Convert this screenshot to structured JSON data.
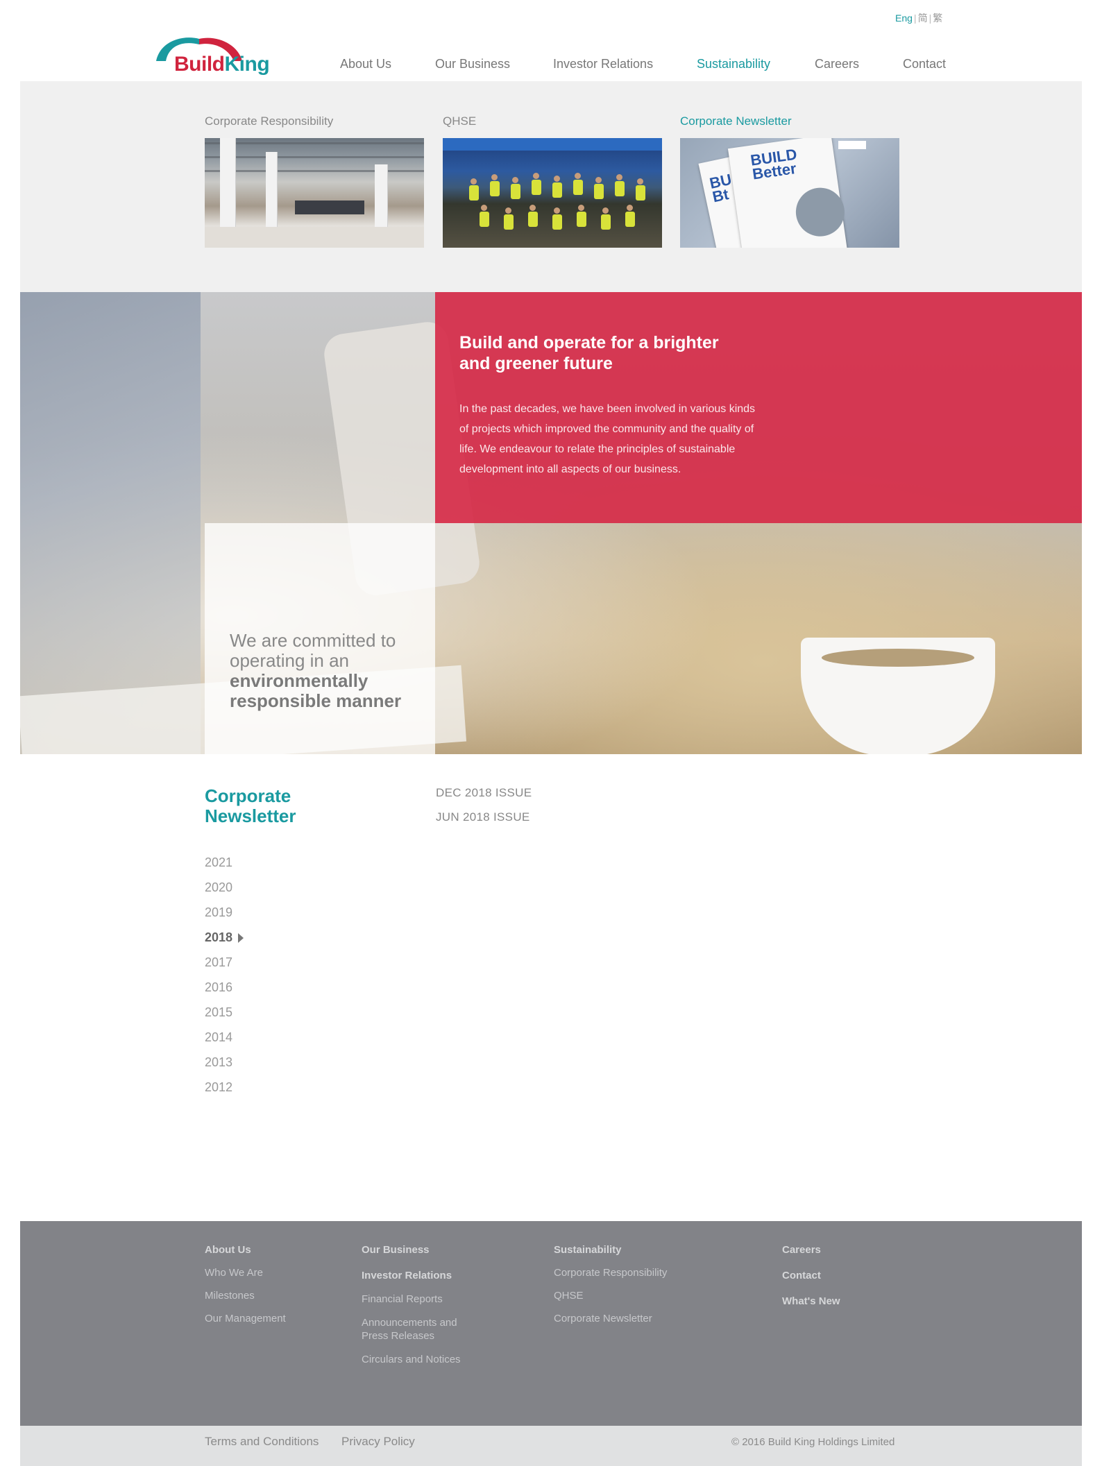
{
  "language": {
    "options": [
      "Eng",
      "简",
      "繁"
    ],
    "active": "Eng"
  },
  "logo": {
    "build": "Build",
    "king": "King"
  },
  "nav": {
    "items": [
      "About Us",
      "Our Business",
      "Investor Relations",
      "Sustainability",
      "Careers",
      "Contact"
    ],
    "active": "Sustainability"
  },
  "submenu": {
    "items": [
      {
        "label": "Corporate Responsibility"
      },
      {
        "label": "QHSE"
      },
      {
        "label": "Corporate Newsletter"
      }
    ],
    "active": "Corporate Newsletter"
  },
  "hero": {
    "heading": "Build and operate for a brighter and greener future",
    "body": "In the past decades, we have been involved in various kinds of projects which improved the community and the quality of life. We endeavour to relate the principles of sustainable development into all aspects of our business.",
    "quote_light": "We are committed to operating in an",
    "quote_bold": "environmentally responsible manner"
  },
  "newsletter": {
    "title": "Corporate Newsletter",
    "issues": [
      "DEC 2018 ISSUE",
      "JUN 2018 ISSUE"
    ],
    "years": [
      "2021",
      "2020",
      "2019",
      "2018",
      "2017",
      "2016",
      "2015",
      "2014",
      "2013",
      "2012"
    ],
    "selected_year": "2018"
  },
  "footer": {
    "about": {
      "heading": "About Us",
      "links": [
        "Who We Are",
        "Milestones",
        "Our Management"
      ]
    },
    "business": {
      "heading": "Our Business"
    },
    "investor": {
      "heading": "Investor Relations",
      "links": [
        "Financial Reports",
        "Announcements and Press Releases",
        "Circulars and Notices"
      ]
    },
    "sustainability": {
      "heading": "Sustainability",
      "links": [
        "Corporate Responsibility",
        "QHSE",
        "Corporate Newsletter"
      ]
    },
    "careers": {
      "heading": "Careers"
    },
    "contact": {
      "heading": "Contact"
    },
    "whats_new": {
      "heading": "What's New"
    },
    "terms": "Terms and Conditions",
    "privacy": "Privacy Policy",
    "copyright": "© 2016 Build King Holdings Limited"
  },
  "colors": {
    "teal": "#1a9aa0",
    "red": "#d6284a",
    "footer_gray": "#828388"
  }
}
